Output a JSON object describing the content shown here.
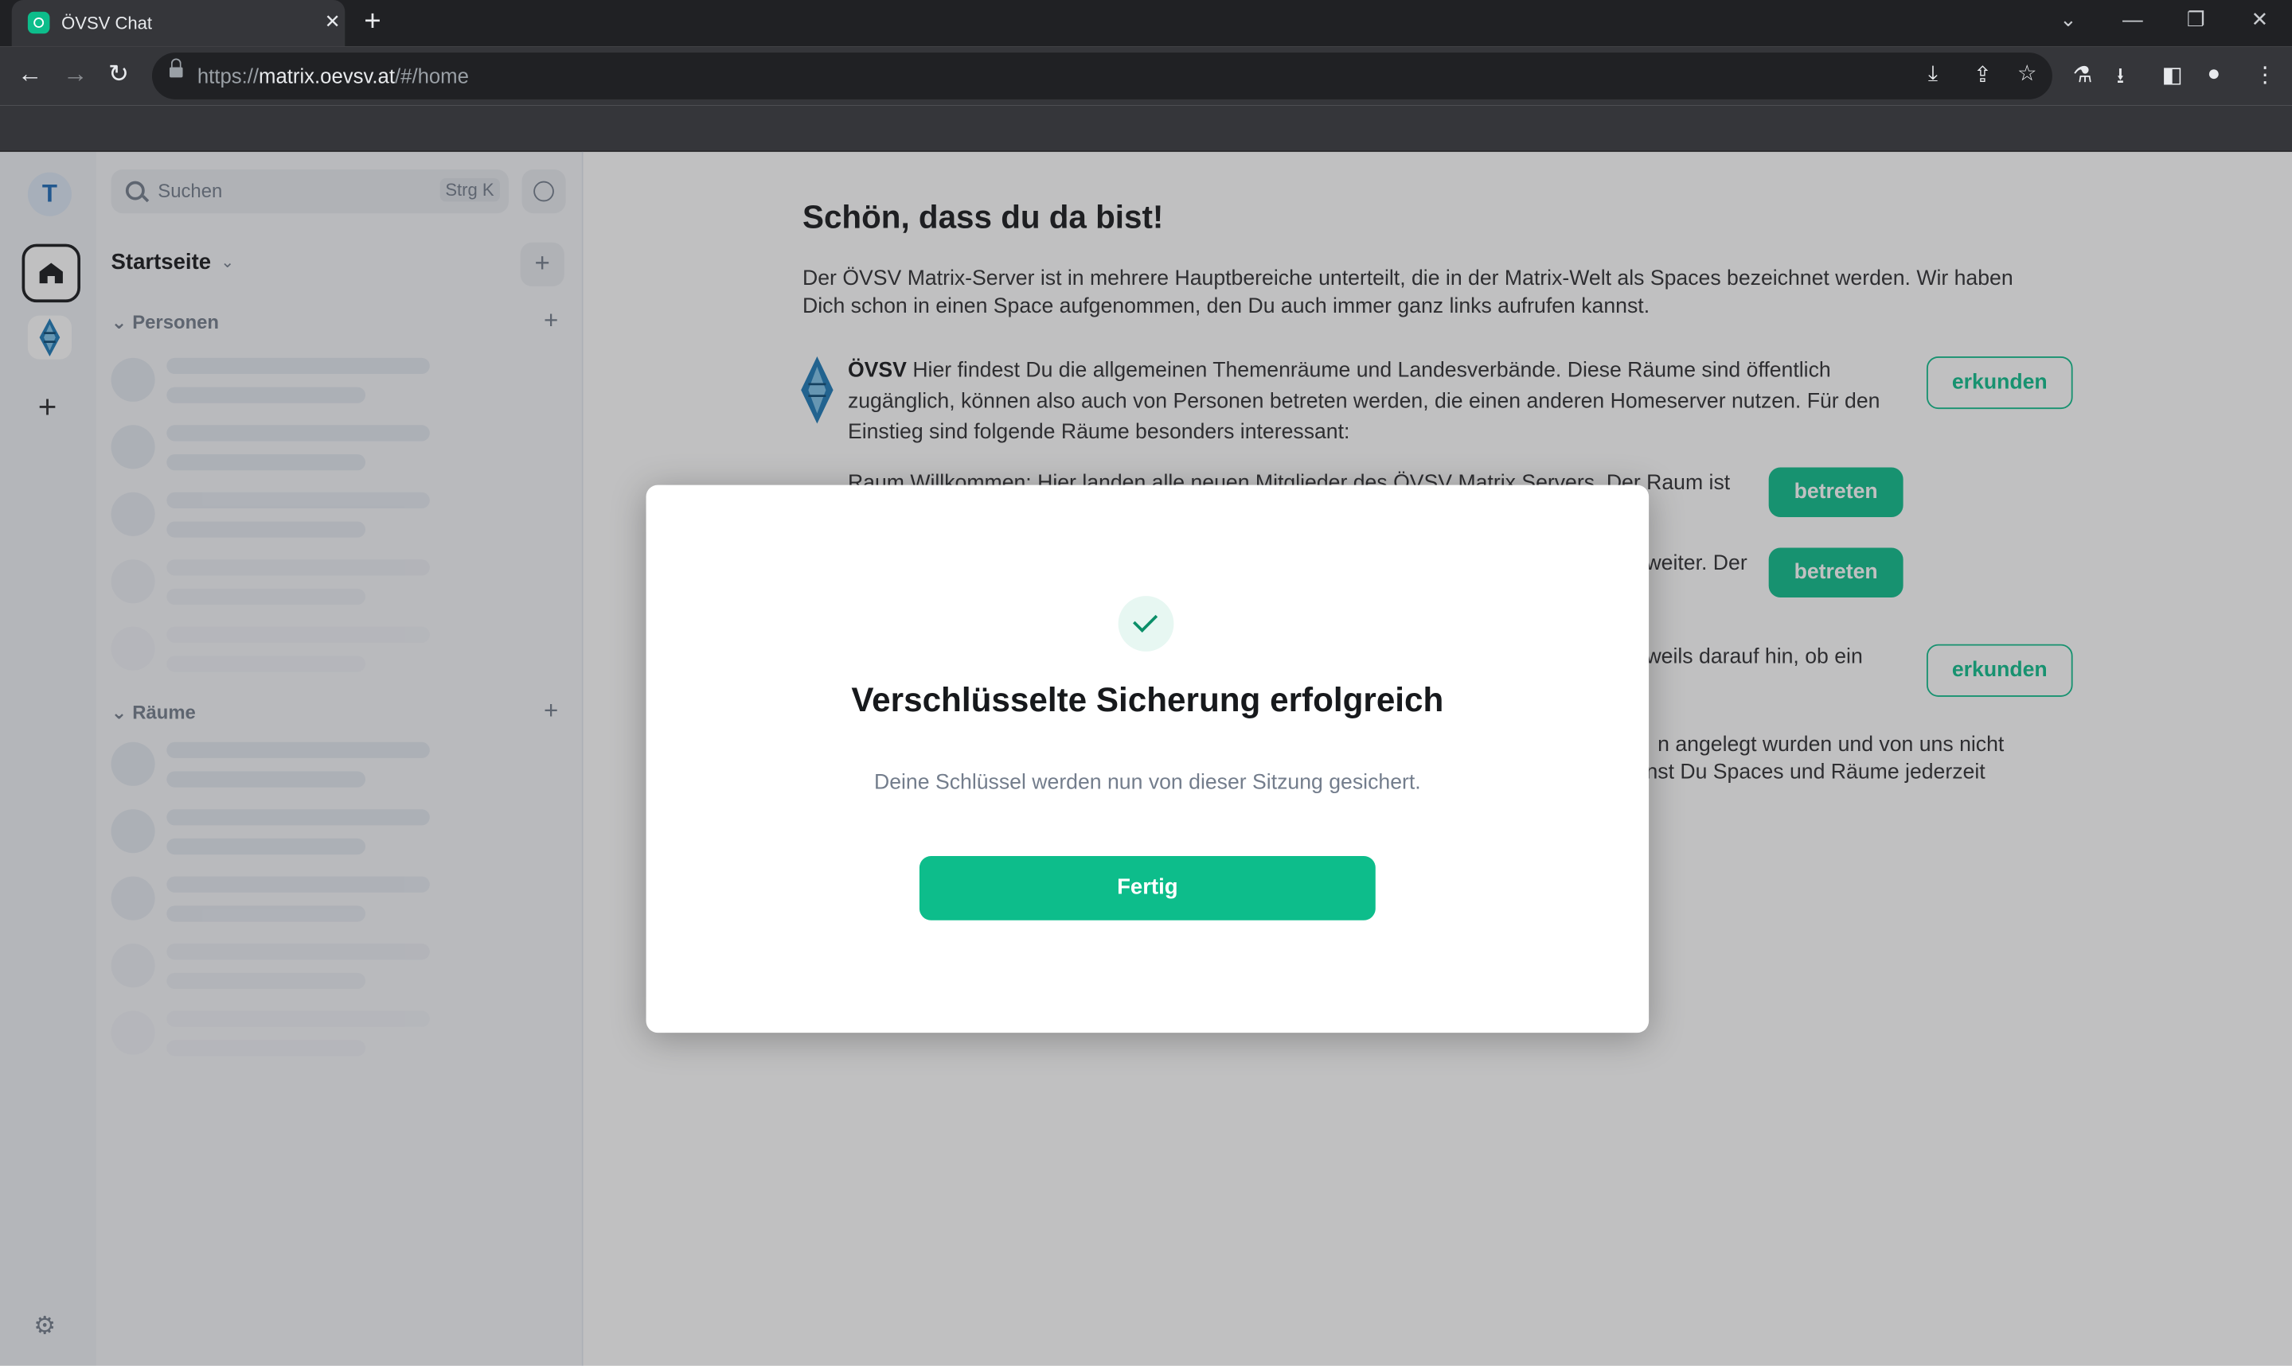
{
  "browser": {
    "tab_title": "ÖVSV Chat",
    "tab_close": "✕",
    "new_tab": "+",
    "url_scheme": "https://",
    "url_host": "matrix.oevsv.at",
    "url_path": "/#/home"
  },
  "icons": {
    "back": "←",
    "forward": "→",
    "reload": "↻",
    "install": "⤓",
    "share": "⇪",
    "star": "☆",
    "labs": "⚗",
    "download": "⭳",
    "sidepanel": "◧",
    "profile": "●",
    "menu": "⋮",
    "chevron_down": "⌄",
    "minimize": "—",
    "restore": "❐",
    "close": "✕"
  },
  "spaces": {
    "avatar_letter": "T",
    "add": "+",
    "settings_icon": "⚙"
  },
  "roomlist": {
    "search_placeholder": "Suchen",
    "search_shortcut": "Strg K",
    "header_title": "Startseite",
    "header_chevron": "⌄",
    "header_plus": "+",
    "section_people": "Personen",
    "section_rooms": "Räume",
    "section_chevron": "⌄",
    "section_plus": "+"
  },
  "main": {
    "title": "Schön, dass du da bist!",
    "intro": "Der ÖVSV Matrix-Server ist in mehrere Hauptbereiche unterteilt, die in der Matrix-Welt als Spaces bezeichnet werden. Wir haben Dich schon in einen Space aufgenommen, den Du auch immer ganz links aufrufen kannst.",
    "space_name": "ÖVSV",
    "space_text": " Hier findest Du die allgemeinen Themenräume und Landesverbände. Diese Räume sind öffentlich zugänglich, können also auch von Personen betreten werden, die einen anderen Homeserver nutzen. Für den Einstieg sind folgende Räume besonders interessant:",
    "explore_label": "erkunden",
    "join_label": "betreten",
    "room1_text": "Raum Willkommen: Hier landen alle neuen Mitglieder des ÖVSV Matrix Servers. Der Raum ist",
    "room2_fragment": "weiter. Der",
    "space2_fragment": "weils darauf hin, ob ein",
    "para_fragment1": "n angelegt wurden und von uns nicht",
    "para_fragment2": "nst Du Spaces und Räume jederzeit"
  },
  "modal": {
    "title": "Verschlüsselte Sicherung erfolgreich",
    "description": "Deine Schlüssel werden nun von dieser Sitzung gesichert.",
    "done_label": "Fertig"
  },
  "colors": {
    "accent": "#0dbd8b",
    "chrome_dark": "#202124",
    "chrome_mid": "#35363a"
  }
}
